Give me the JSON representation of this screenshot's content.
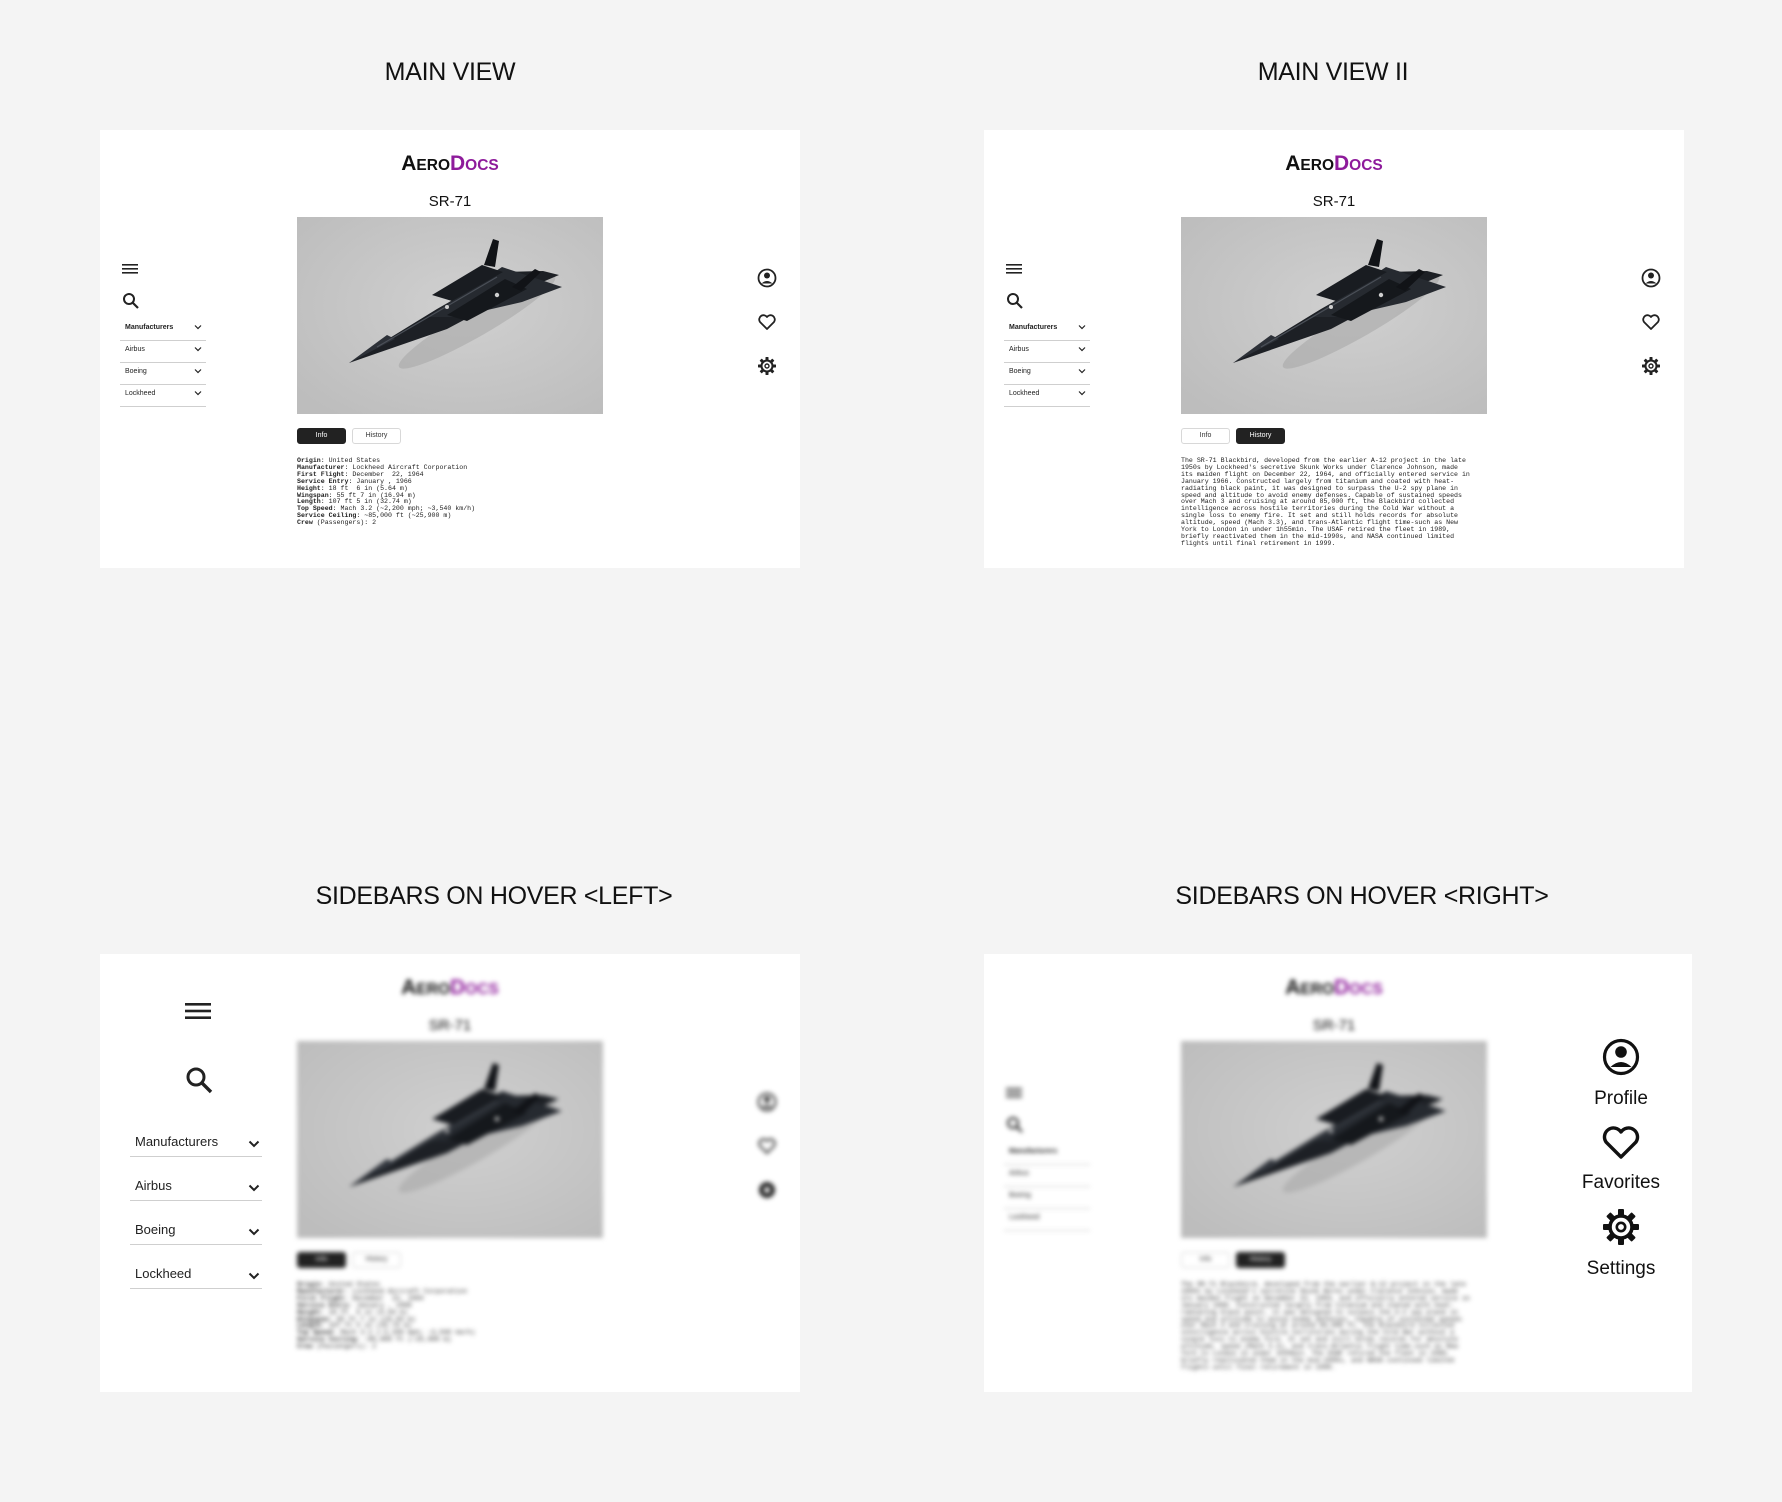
{
  "sections": {
    "main_view": "MAIN VIEW",
    "main_view_ii": "MAIN VIEW II",
    "hover_left": "SIDEBARS ON HOVER <LEFT>",
    "hover_right": "SIDEBARS ON HOVER <RIGHT>"
  },
  "app": {
    "logo_aero_first": "A",
    "logo_aero_rest": "ERO",
    "logo_docs_first": "D",
    "logo_docs_rest": "OCS",
    "aircraft_name": "SR-71",
    "accent_color": "#8e1b9b"
  },
  "tabs": {
    "info": "Info",
    "history": "History"
  },
  "left_sidebar": {
    "manufacturers": "Manufacturers",
    "airbus": "Airbus",
    "boeing": "Boeing",
    "lockheed": "Lockheed",
    "icons": [
      "menu-icon",
      "search-icon",
      "chevron-down-icon"
    ]
  },
  "right_sidebar": {
    "profile": "Profile",
    "favorites": "Favorites",
    "settings": "Settings",
    "icons": [
      "profile-icon",
      "heart-icon",
      "gear-icon"
    ]
  },
  "specs": [
    {
      "k": "Origin",
      "v": ": United States"
    },
    {
      "k": "Manufacturer",
      "v": ": Lockheed Aircraft Corporation"
    },
    {
      "k": "First Flight",
      "v": ": December  22, 1964"
    },
    {
      "k": "Service Entry",
      "v": ": January , 1966"
    },
    {
      "k": "Height",
      "v": ": 18 ft  6 in (5.64 m)"
    },
    {
      "k": "Wingspan",
      "v": ": 55 ft 7 in (16.94 m)"
    },
    {
      "k": "Length",
      "v": ": 107 ft 5 in (32.74 m)"
    },
    {
      "k": "Top Speed",
      "v": ": Mach 3.2 (~2,200 mph; ~3,540 km/h)"
    },
    {
      "k": "Service Ceiling",
      "v": ": ~85,000 ft (~25,900 m)"
    },
    {
      "k": "Crew",
      "v": " (Passengers): 2"
    }
  ],
  "history_lines": [
    "The SR-71 Blackbird, developed from the earlier A-12 project in the late",
    "1950s by Lockheed's secretive Skunk Works under Clarence Johnson, made",
    "its maiden flight on December 22, 1964, and officially entered service in",
    "January 1966. Constructed largely from titanium and coated with heat-",
    "radiating black paint, it was designed to surpass the U-2 spy plane in",
    "speed and altitude to avoid enemy defenses. Capable of sustained speeds",
    "over Mach 3 and cruising at around 85,000 ft, the Blackbird collected",
    "intelligence across hostile territories during the Cold War without a",
    "single loss to enemy fire. It set and still holds records for absolute",
    "altitude, speed (Mach 3.3), and trans-Atlantic flight time-such as New",
    "York to London in under 1h55min. The USAF retired the fleet in 1989,",
    "briefly reactivated them in the mid-1990s, and NASA continued limited",
    "flights until final retirement in 1999."
  ]
}
